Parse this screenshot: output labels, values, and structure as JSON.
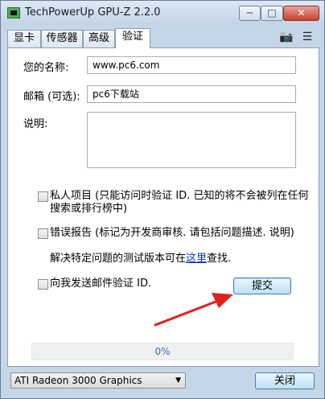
{
  "window": {
    "title": "TechPowerUp GPU-Z 2.2.0",
    "min_glyph": "─",
    "max_glyph": "□",
    "close_glyph": "✕"
  },
  "tabs": [
    {
      "label": "显卡"
    },
    {
      "label": "传感器"
    },
    {
      "label": "高级"
    },
    {
      "label": "验证"
    }
  ],
  "toolbar": {
    "camera_glyph": "📷",
    "menu_glyph": "☰"
  },
  "form": {
    "name_label": "您的名称:",
    "name_value": "www.pc6.com",
    "email_label": "邮箱 (可选):",
    "email_value": "pc6下载站",
    "desc_label": "说明:",
    "desc_value": "",
    "private_line1": "私人项目 (只能访问时验证 ID. 已知的将不会被列在任何",
    "private_line2": "搜索或排行榜中)",
    "error_report": "错误报告 (标记为开发商审核. 请包括问题描述. 说明)",
    "test_note_prefix": "解决特定问题的测试版本可在",
    "test_note_link": "这里",
    "test_note_suffix": "查找.",
    "email_me": "向我发送邮件验证 ID.",
    "submit_label": "提交",
    "progress_text": "0%",
    "progress_value": 0
  },
  "footer": {
    "gpu_selected": "ATI Radeon 3000 Graphics",
    "close_label": "关闭"
  },
  "colors": {
    "annotation_arrow": "#e0201c",
    "link": "#0033cc"
  }
}
